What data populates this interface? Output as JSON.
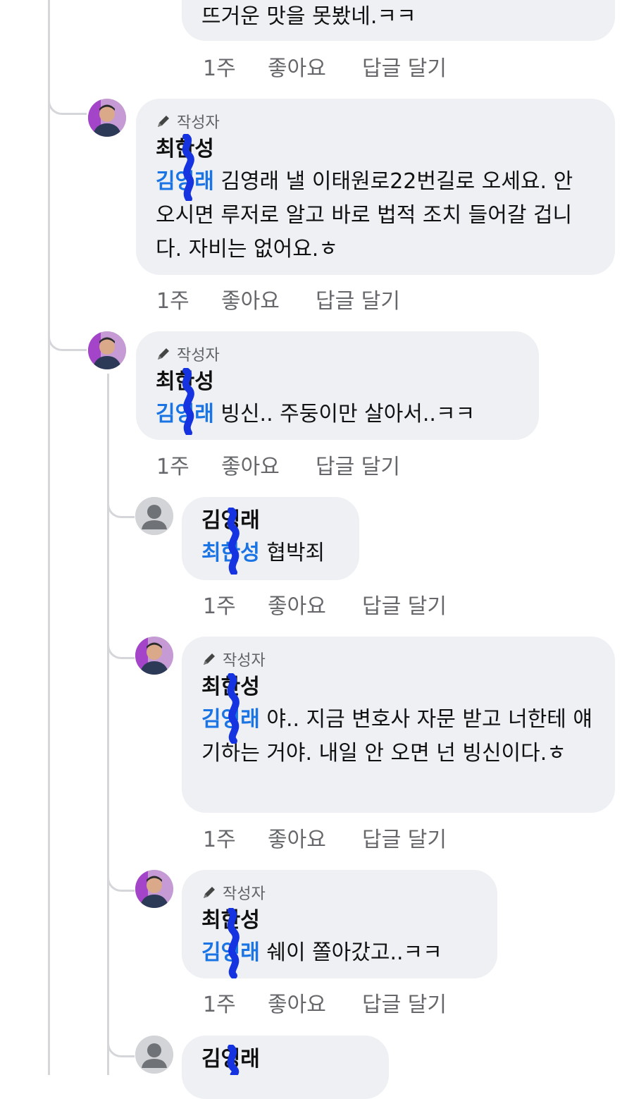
{
  "thread": {
    "top_comment": {
      "text": "뜨거운 맛을 못봤네.ㅋㅋ"
    },
    "top_actions": {
      "time": "1주",
      "like": "좋아요",
      "reply": "답글 달기"
    },
    "comments": [
      {
        "badge": "작성자",
        "author": "최한성",
        "mention": "김영래",
        "text": " 김영래 낼 이태원로22번길로 오세요. 안 오시면 루저로 알고 바로 법적 조치 들어갈 겁니다. 자비는 없어요.ㅎ",
        "time": "1주",
        "like": "좋아요",
        "reply": "답글 달기"
      },
      {
        "badge": "작성자",
        "author": "최한성",
        "mention": "김영래",
        "text": " 빙신.. 주둥이만 살아서..ㅋㅋ",
        "time": "1주",
        "like": "좋아요",
        "reply": "답글 달기"
      },
      {
        "author": "김영래",
        "mention": "최한성",
        "text": " 협박죄",
        "time": "1주",
        "like": "좋아요",
        "reply": "답글 달기"
      },
      {
        "badge": "작성자",
        "author": "최한성",
        "mention": "김영래",
        "text": " 야.. 지금 변호사 자문 받고 너한테 얘기하는 거야. 내일 안 오면 넌 빙신이다.ㅎ",
        "time": "1주",
        "like": "좋아요",
        "reply": "답글 달기"
      },
      {
        "badge": "작성자",
        "author": "최한성",
        "mention": "김영래",
        "text": " 쉐이 쫄아갔고..ㅋㅋ",
        "time": "1주",
        "like": "좋아요",
        "reply": "답글 달기"
      },
      {
        "author": "김영래"
      }
    ]
  },
  "icons": {
    "author_badge_icon": "pencil-icon",
    "default_avatar_icon": "person-icon"
  },
  "colors": {
    "bubble": "#eef0f4",
    "mention": "#1b74e4",
    "meta_text": "#65676b",
    "redaction_scribble": "#1533e0"
  }
}
